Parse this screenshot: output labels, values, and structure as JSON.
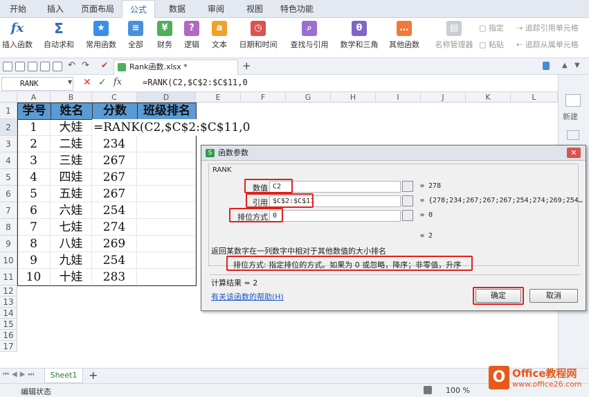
{
  "menu_tabs": [
    "开始",
    "插入",
    "页面布局",
    "公式",
    "数据",
    "审阅",
    "视图",
    "特色功能"
  ],
  "active_tab": "公式",
  "ribbon": {
    "insert_function": "插入函数",
    "autosum": "自动求和",
    "common": "常用函数",
    "all": "全部",
    "finance": "财务",
    "logic": "逻辑",
    "text": "文本",
    "datetime": "日期和时间",
    "lookup": "查找与引用",
    "math": "数学和三角",
    "other": "其他函数",
    "name_manager": "名称管理器",
    "specify": "指定",
    "paste": "粘贴",
    "trace_precedents": "追踪引用单元格",
    "trace_dependents": "追踪从属单元格"
  },
  "doc_tab": "Rank函数.xlsx *",
  "formula_bar": {
    "name_box": "RANK",
    "formula": "=RANK(C2,$C$2:$C$11,0"
  },
  "columns": [
    "A",
    "B",
    "C",
    "D",
    "E",
    "F",
    "G",
    "H",
    "I",
    "J",
    "K",
    "L"
  ],
  "rows": [
    "1",
    "2",
    "3",
    "4",
    "5",
    "6",
    "7",
    "8",
    "9",
    "10",
    "11",
    "12",
    "13",
    "14",
    "15",
    "16",
    "17"
  ],
  "table": {
    "headers": [
      "学号",
      "姓名",
      "分数",
      "班级排名"
    ],
    "row2_formula": "=RANK(C2,$C$2:$C$11,0",
    "data": [
      [
        "1",
        "大娃"
      ],
      [
        "2",
        "二娃",
        "234"
      ],
      [
        "3",
        "三娃",
        "267"
      ],
      [
        "4",
        "四娃",
        "267"
      ],
      [
        "5",
        "五娃",
        "267"
      ],
      [
        "6",
        "六娃",
        "254"
      ],
      [
        "7",
        "七娃",
        "274"
      ],
      [
        "8",
        "八娃",
        "269"
      ],
      [
        "9",
        "九娃",
        "254"
      ],
      [
        "10",
        "十娃",
        "283"
      ]
    ]
  },
  "right_pane": {
    "new": "新建"
  },
  "sheet_tab": "Sheet1",
  "status": {
    "mode": "编辑状态",
    "zoom": "100 %"
  },
  "dialog": {
    "title": "函数参数",
    "function": "RANK",
    "args": [
      {
        "label": "数值",
        "input": "C2",
        "value": "= 278"
      },
      {
        "label": "引用",
        "input": "$C$2:$C$11",
        "value": "= {278;234;267;267;267;254;274;269;254…"
      },
      {
        "label": "排位方式",
        "input": "0",
        "value": "= 0"
      }
    ],
    "result_eq": "= 2",
    "description": "返回某数字在一列数字中相对于其他数值的大小排名",
    "arg_help": "排位方式:  指定排位的方式。如果为 0 或忽略，降序；非零值，升序",
    "calc_result": "计算结果 = 2",
    "help_link": "有关该函数的帮助(H)",
    "ok": "确定",
    "cancel": "取消"
  },
  "watermark": {
    "brand": "Office教程网",
    "url": "www.office26.com"
  },
  "colors": {
    "accent": "#2d6db5",
    "header_fill": "#5b9bd5",
    "highlight": "#e0201c",
    "logo": "#e8591a"
  }
}
